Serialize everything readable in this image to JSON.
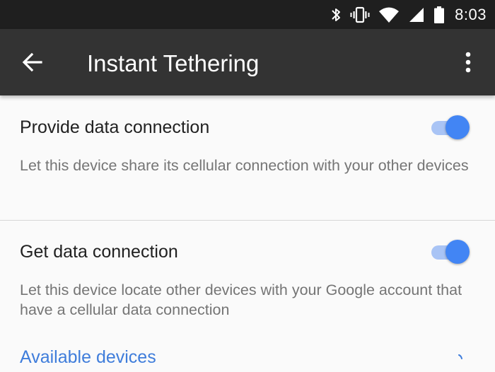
{
  "status_bar": {
    "time": "8:03",
    "icons": [
      "bluetooth-icon",
      "vibrate-icon",
      "wifi-icon",
      "cellular-signal-icon",
      "battery-icon"
    ]
  },
  "app_bar": {
    "title": "Instant Tethering",
    "back_icon": "arrow-back-icon",
    "menu_icon": "more-vert-icon"
  },
  "settings": [
    {
      "label": "Provide data connection",
      "description": "Let this device share its cellular connection with your other devices",
      "enabled": true
    },
    {
      "label": "Get data connection",
      "description": "Let this device locate other devices with your Google account that have a cellular data connection",
      "enabled": true
    }
  ],
  "available_devices": {
    "label": "Available devices"
  },
  "colors": {
    "accent": "#4285f4",
    "app_bar": "#333333",
    "status_bar": "#1f1f1f",
    "link": "#3f7ddb"
  }
}
